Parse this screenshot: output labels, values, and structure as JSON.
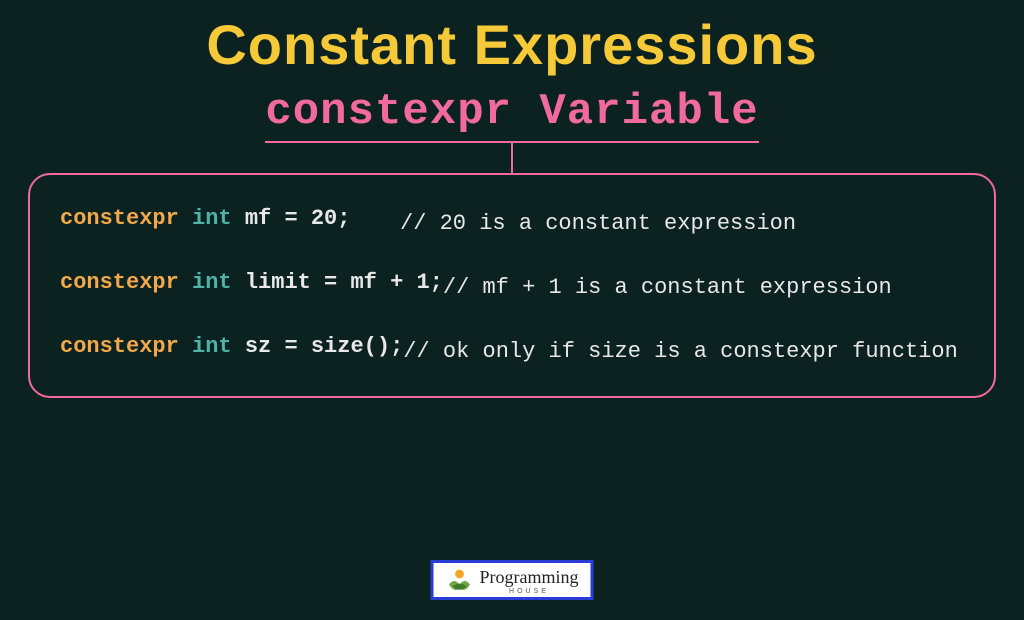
{
  "title": "Constant Expressions",
  "subtitle": "constexpr Variable",
  "code": {
    "lines": [
      {
        "kw1": "constexpr",
        "kw2": "int",
        "rest": " mf = 20;",
        "comment": "// 20 is a constant expression"
      },
      {
        "kw1": "constexpr",
        "kw2": "int",
        "rest": " limit = mf + 1;",
        "comment": "// mf + 1 is a constant expression"
      },
      {
        "kw1": "constexpr",
        "kw2": "int",
        "rest": " sz = size();",
        "comment": "// ok only if size is a constexpr function"
      }
    ]
  },
  "logo": {
    "main": "Programming",
    "sub": "HOUSE"
  }
}
